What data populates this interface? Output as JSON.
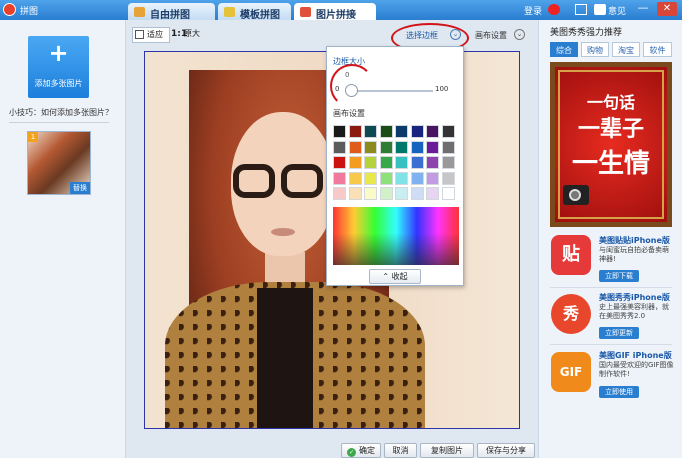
{
  "window": {
    "title": "拼图",
    "login": "登录",
    "feedback": "意见",
    "minimize": "—",
    "close": "✕"
  },
  "tabs": [
    {
      "label": "自由拼图",
      "icon": "free-collage-icon",
      "active": false
    },
    {
      "label": "模板拼图",
      "icon": "template-collage-icon",
      "active": false
    },
    {
      "label": "图片拼接",
      "icon": "image-join-icon",
      "active": true
    }
  ],
  "left": {
    "add_button": "添加多张图片",
    "add_symbol": "+",
    "tip": "小技巧：如何添加多张图片？",
    "thumb_index": "1",
    "thumb_replace": "替换"
  },
  "toolbar": {
    "fit": "适应",
    "original_icon": "1:1",
    "original": "原大",
    "select_border": "选择边框",
    "canvas_settings": "画布设置",
    "chevron": "⌄"
  },
  "popup": {
    "border_size_label": "边框大小",
    "slider_value": "0",
    "slider_min": "0",
    "slider_max": "100",
    "slider_level_percent": 0,
    "canvas_settings_label": "画布设置",
    "collapse": "收起",
    "palette": [
      [
        "#1a1a1a",
        "#8b1a10",
        "#0e4a52",
        "#1b4d17",
        "#0c3a6a",
        "#1a237e",
        "#4a1560",
        "#333333"
      ],
      [
        "#5c5c5c",
        "#e05b1a",
        "#8c8c1e",
        "#2e7d32",
        "#00796b",
        "#1565c0",
        "#6a1b9a",
        "#6e6e6e"
      ],
      [
        "#cc1111",
        "#f49b22",
        "#b6d23a",
        "#38a84a",
        "#38c1c1",
        "#3b6fd1",
        "#8e44ad",
        "#999999"
      ],
      [
        "#f07a9b",
        "#f7c948",
        "#e8e84a",
        "#8ee07a",
        "#7fe3e8",
        "#7fb2f0",
        "#c39be3",
        "#c6c6c6"
      ],
      [
        "#f7c9c9",
        "#fbe0b7",
        "#fbfbc9",
        "#d3f1c9",
        "#c9eef1",
        "#cfdcf5",
        "#e6d4f1",
        "#ffffff"
      ]
    ]
  },
  "bottom": {
    "confirm": "确定",
    "confirm_check": "✓",
    "cancel": "取消",
    "copy": "复制图片",
    "save_share": "保存与分享"
  },
  "right": {
    "title": "美图秀秀强力推荐",
    "tabs": [
      "综合",
      "购物",
      "淘宝",
      "软件"
    ],
    "ad_lines": [
      "一句话",
      "一辈子",
      "一生情"
    ],
    "apps": [
      {
        "name": "美图贴贴iPhone版",
        "desc": "与闺蜜玩自拍必备卖萌神器!",
        "button": "立即下载",
        "icon_text": "贴",
        "color": "#e63a3a"
      },
      {
        "name": "美图秀秀iPhone版",
        "desc": "史上最强美容利器，就在美图秀秀2.0",
        "button": "立即更新",
        "icon_text": "秀",
        "color": "#e8472b"
      },
      {
        "name": "美图GIF iPhone版",
        "desc": "国内最受欢迎的GIF图像制作软件!",
        "button": "立即使用",
        "icon_text": "GIF",
        "color": "#f08a1a"
      }
    ]
  }
}
